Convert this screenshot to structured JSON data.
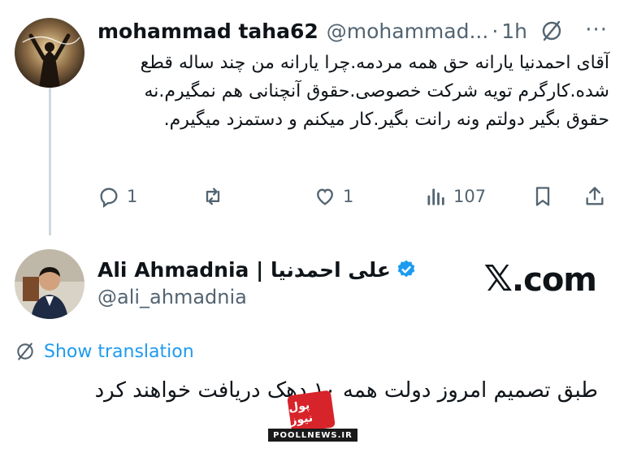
{
  "tweet1": {
    "display_name": "mohammad taha62",
    "handle": "@mohammad...",
    "separator": "·",
    "time": "1h",
    "text": "آقای احمدنیا یارانه حق همه مردمه.چرا یارانه من چند ساله قطع شده.کارگرم تویه شرکت خصوصی.حقوق آنچنانی هم نمگیرم.نه حقوق بگیر دولتم ونه رانت بگیر.کار میکنم و دستمزد میگیرم.",
    "actions": {
      "reply_count": "1",
      "like_count": "1",
      "views_count": "107"
    }
  },
  "tweet2": {
    "display_name": "Ali Ahmadnia | علی احمدنیا",
    "handle": "@ali_ahmadnia",
    "translate_label": "Show translation",
    "text": "طبق تصمیم امروز دولت همه ۱۰ دهک دریافت خواهند کرد"
  },
  "brand": {
    "x_mark": "𝕏",
    "domain": ".com"
  },
  "watermark": {
    "logo_text": "پول نیوز",
    "url": "POOLLNEWS.IR"
  },
  "colors": {
    "link": "#1d9bf0",
    "muted": "#536471",
    "verified": "#1d9bf0",
    "watermark_red": "#d7242a"
  }
}
